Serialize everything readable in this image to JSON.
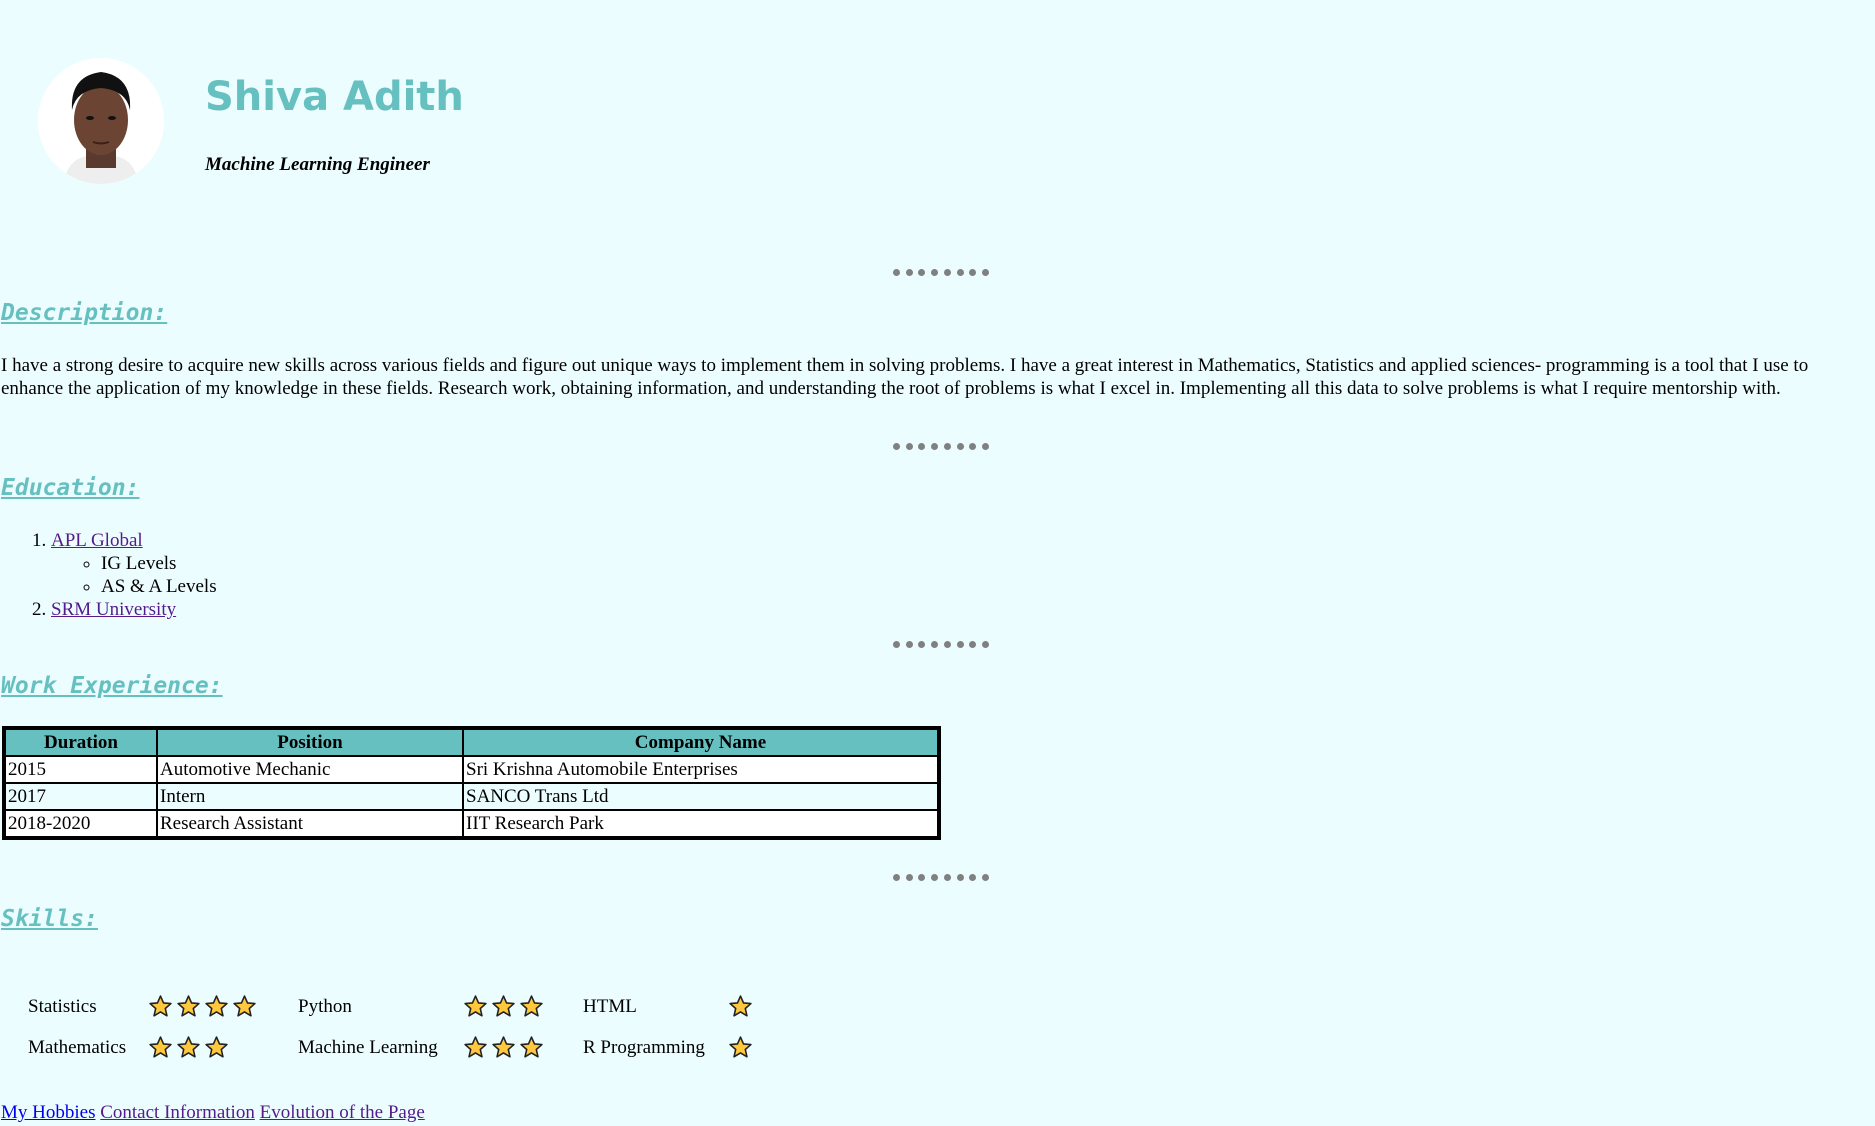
{
  "header": {
    "name": "Shiva Adith",
    "title": "Machine Learning Engineer"
  },
  "sections": {
    "description": {
      "heading": "Description:",
      "text": "I have a strong desire to acquire new skills across various fields and figure out unique ways to implement them in solving problems. I have a great interest in Mathematics, Statistics and applied sciences- programming is a tool that I use to enhance the application of my knowledge in these fields. Research work, obtaining information, and understanding the root of problems is what I excel in. Implementing all this data to solve problems is what I require mentorship with."
    },
    "education": {
      "heading": "Education:",
      "items": [
        {
          "label": "APL Global",
          "sub": [
            "IG Levels",
            "AS & A Levels"
          ]
        },
        {
          "label": "SRM University"
        }
      ]
    },
    "work": {
      "heading": "Work Experience:",
      "columns": [
        "Duration",
        "Position",
        "Company Name"
      ],
      "rows": [
        [
          "2015",
          "Automotive Mechanic",
          "Sri Krishna Automobile Enterprises"
        ],
        [
          "2017",
          "Intern",
          "SANCO Trans Ltd"
        ],
        [
          "2018-2020",
          "Research Assistant",
          "IIT Research Park"
        ]
      ]
    },
    "skills": {
      "heading": "Skills:",
      "items": [
        {
          "name": "Statistics",
          "rating": 4
        },
        {
          "name": "Python",
          "rating": 3
        },
        {
          "name": "HTML",
          "rating": 1
        },
        {
          "name": "Mathematics",
          "rating": 3
        },
        {
          "name": "Machine Learning",
          "rating": 3
        },
        {
          "name": "R Programming",
          "rating": 1
        }
      ]
    }
  },
  "footer_links": [
    "My Hobbies",
    "Contact Information",
    "Evolution of the Page"
  ],
  "colors": {
    "accent": "#66c0c0",
    "background": "#ecfdff",
    "star": "#ffc83d"
  }
}
